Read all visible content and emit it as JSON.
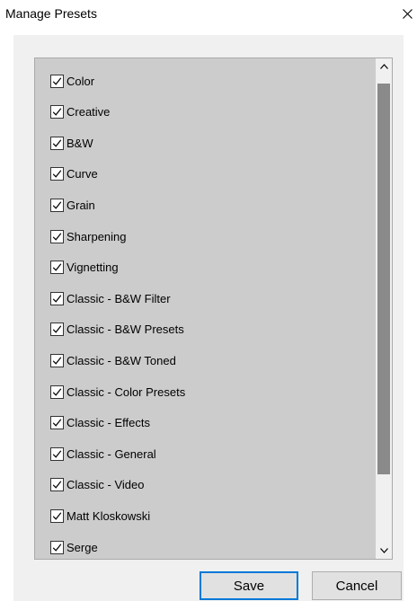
{
  "dialog": {
    "title": "Manage Presets",
    "close_icon": "close-icon"
  },
  "presets": [
    {
      "label": "Color",
      "checked": true
    },
    {
      "label": "Creative",
      "checked": true
    },
    {
      "label": "B&W",
      "checked": true
    },
    {
      "label": "Curve",
      "checked": true
    },
    {
      "label": "Grain",
      "checked": true
    },
    {
      "label": "Sharpening",
      "checked": true
    },
    {
      "label": "Vignetting",
      "checked": true
    },
    {
      "label": "Classic - B&W Filter",
      "checked": true
    },
    {
      "label": "Classic - B&W Presets",
      "checked": true
    },
    {
      "label": "Classic - B&W Toned",
      "checked": true
    },
    {
      "label": "Classic - Color Presets",
      "checked": true
    },
    {
      "label": "Classic - Effects",
      "checked": true
    },
    {
      "label": "Classic - General",
      "checked": true
    },
    {
      "label": "Classic - Video",
      "checked": true
    },
    {
      "label": "Matt Kloskowski",
      "checked": true
    },
    {
      "label": "Serge",
      "checked": true
    }
  ],
  "scrollbar": {
    "up_icon": "chevron-up-icon",
    "down_icon": "chevron-down-icon"
  },
  "buttons": {
    "save": "Save",
    "cancel": "Cancel"
  },
  "colors": {
    "list_background": "#cccccc",
    "dialog_body": "#f0f0f0",
    "default_button_border": "#0078d7",
    "scroll_thumb": "#8a8a8a"
  }
}
